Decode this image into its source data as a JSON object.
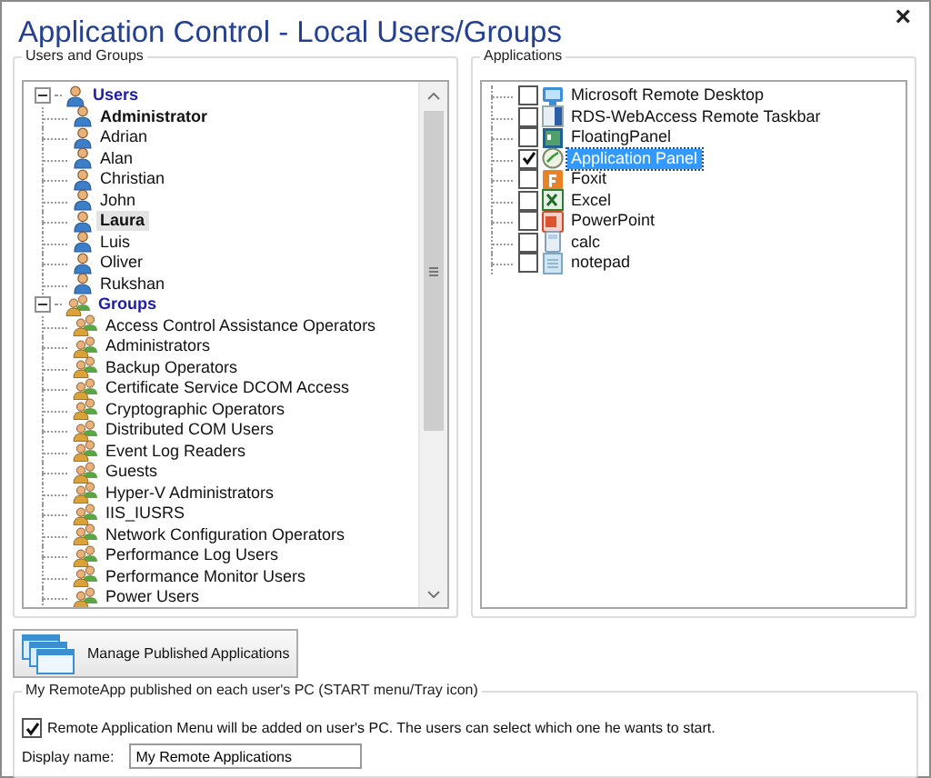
{
  "window": {
    "title": "Application Control - Local Users/Groups",
    "close": "×"
  },
  "users_and_groups": {
    "title": "Users and Groups",
    "nodes": [
      {
        "label": "Users",
        "kind": "users",
        "expanded": true,
        "children": [
          {
            "label": "Administrator",
            "bold": true,
            "selected": false
          },
          {
            "label": "Adrian",
            "bold": false,
            "selected": false
          },
          {
            "label": "Alan",
            "bold": false,
            "selected": false
          },
          {
            "label": "Christian",
            "bold": false,
            "selected": false
          },
          {
            "label": "John",
            "bold": false,
            "selected": false
          },
          {
            "label": "Laura",
            "bold": true,
            "selected": true
          },
          {
            "label": "Luis",
            "bold": false,
            "selected": false
          },
          {
            "label": "Oliver",
            "bold": false,
            "selected": false
          },
          {
            "label": "Rukshan",
            "bold": false,
            "selected": false
          }
        ]
      },
      {
        "label": "Groups",
        "kind": "groups",
        "expanded": true,
        "children": [
          {
            "label": "Access Control Assistance Operators",
            "bold": false,
            "selected": false
          },
          {
            "label": "Administrators",
            "bold": false,
            "selected": false
          },
          {
            "label": "Backup Operators",
            "bold": false,
            "selected": false
          },
          {
            "label": "Certificate Service DCOM Access",
            "bold": false,
            "selected": false
          },
          {
            "label": "Cryptographic Operators",
            "bold": false,
            "selected": false
          },
          {
            "label": "Distributed COM Users",
            "bold": false,
            "selected": false
          },
          {
            "label": "Event Log Readers",
            "bold": false,
            "selected": false
          },
          {
            "label": "Guests",
            "bold": false,
            "selected": false
          },
          {
            "label": "Hyper-V Administrators",
            "bold": false,
            "selected": false
          },
          {
            "label": "IIS_IUSRS",
            "bold": false,
            "selected": false
          },
          {
            "label": "Network Configuration Operators",
            "bold": false,
            "selected": false
          },
          {
            "label": "Performance Log Users",
            "bold": false,
            "selected": false
          },
          {
            "label": "Performance Monitor Users",
            "bold": false,
            "selected": false
          },
          {
            "label": "Power Users",
            "bold": false,
            "selected": false
          }
        ]
      }
    ]
  },
  "applications": {
    "title": "Applications",
    "items": [
      {
        "label": "Microsoft Remote Desktop",
        "kind": "monitor",
        "checked": false,
        "selected": false
      },
      {
        "label": "RDS-WebAccess Remote Taskbar",
        "kind": "taskbar",
        "checked": false,
        "selected": false
      },
      {
        "label": "FloatingPanel",
        "kind": "panel",
        "checked": false,
        "selected": false
      },
      {
        "label": "Application Panel",
        "kind": "gauge",
        "checked": true,
        "selected": true
      },
      {
        "label": "Foxit",
        "kind": "document",
        "checked": false,
        "selected": false
      },
      {
        "label": "Excel",
        "kind": "spreadsheet",
        "checked": false,
        "selected": false
      },
      {
        "label": "PowerPoint",
        "kind": "slides",
        "checked": false,
        "selected": false
      },
      {
        "label": "calc",
        "kind": "calculator",
        "checked": false,
        "selected": false
      },
      {
        "label": "notepad",
        "kind": "notepad",
        "checked": false,
        "selected": false
      }
    ]
  },
  "manage_button": {
    "label": "Manage Published Applications"
  },
  "remote_app": {
    "title": "My RemoteApp published on each user's PC (START menu/Tray icon)",
    "checkbox": {
      "label": "Remote Application Menu will be added on user's PC. The users can select which one he wants to start.",
      "checked": true
    },
    "display_name": {
      "label": "Display name:",
      "value": "My Remote Applications"
    }
  }
}
